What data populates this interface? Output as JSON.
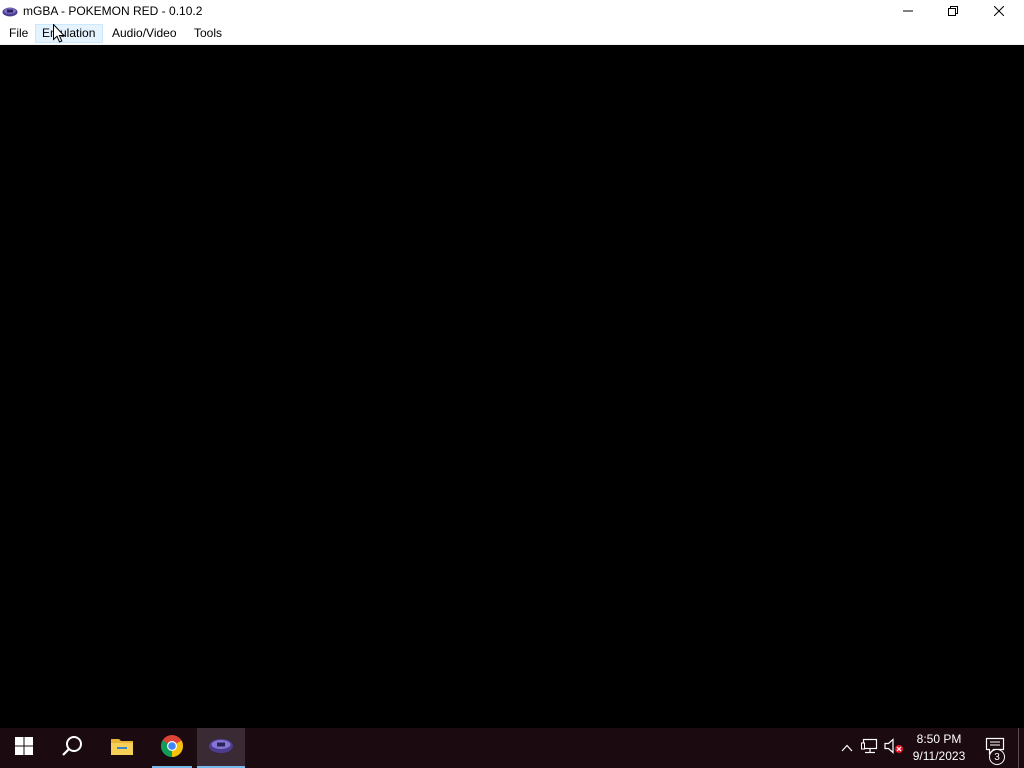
{
  "window": {
    "title": "mGBA - POKEMON RED - 0.10.2",
    "app_icon": "mgba-console-icon",
    "controls": {
      "minimize": "minimize-icon",
      "maximize": "restore-icon",
      "close": "close-icon"
    }
  },
  "menubar": {
    "items": [
      {
        "label": "File"
      },
      {
        "label": "Emulation"
      },
      {
        "label": "Audio/Video"
      },
      {
        "label": "Tools"
      }
    ],
    "hovered": "Emulation"
  },
  "viewport": {
    "background": "#000000"
  },
  "taskbar": {
    "pinned": [
      {
        "name": "start",
        "icon": "windows-logo-icon"
      },
      {
        "name": "search",
        "icon": "search-icon"
      },
      {
        "name": "file-explorer",
        "icon": "folder-icon"
      },
      {
        "name": "chrome",
        "icon": "chrome-icon"
      },
      {
        "name": "mgba",
        "icon": "mgba-console-icon",
        "active": true
      }
    ],
    "tray": {
      "icons": [
        "chevron-up-icon",
        "network-icon",
        "volume-muted-icon"
      ],
      "time": "8:50 PM",
      "date": "9/11/2023",
      "notification_count": "3"
    }
  },
  "colors": {
    "taskbar_bg": "#1b0a10",
    "accent": "#76b9ed",
    "menu_hover": "#e5f3ff"
  }
}
